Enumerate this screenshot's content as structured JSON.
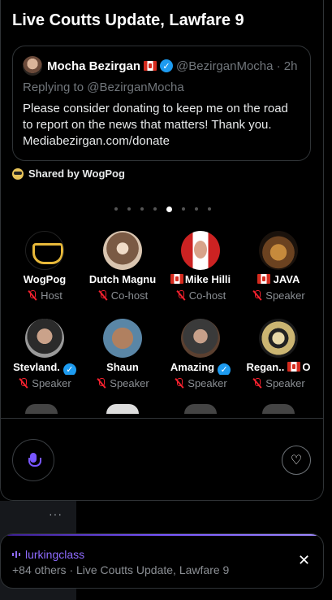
{
  "space": {
    "title": "Live Coutts Update, Lawfare 9"
  },
  "pinned_tweet": {
    "author_name": "Mocha Bezirgan",
    "handle_time": "@BezirganMocha · 2h",
    "replying_to": "Replying to @BezirganMocha",
    "text": "Please consider donating to keep me on the road to report on the news that matters! Thank you. Mediabezirgan.com/donate",
    "shared_by": "Shared by WogPog"
  },
  "pager": {
    "total": 8,
    "active_index": 4
  },
  "speakers": [
    {
      "name": "WogPog",
      "role": "Host"
    },
    {
      "name": "Dutch Magnu",
      "role": "Co-host"
    },
    {
      "name": "Mike Hilli",
      "role": "Co-host"
    },
    {
      "name": "JAVA",
      "role": "Speaker"
    },
    {
      "name": "Stevland.",
      "role": "Speaker"
    },
    {
      "name": "Shaun",
      "role": "Speaker"
    },
    {
      "name": "Amazing",
      "role": "Speaker"
    },
    {
      "name": "Regan..",
      "role": "Speaker"
    }
  ],
  "speaker_name_suffixes": {
    "regan": "O"
  },
  "controls": {
    "more": "···"
  },
  "mini_player": {
    "host": "lurkingclass",
    "subtitle": "+84 others · Live Coutts Update, Lawfare 9",
    "close": "✕"
  },
  "colors": {
    "accent": "#7856ff",
    "verified": "#1d9bf0",
    "muted": "#f4212e"
  },
  "icons": [
    "mic-icon",
    "add-reaction-icon",
    "close-icon",
    "verified-icon",
    "canada-flag-icon",
    "mic-muted-icon"
  ]
}
